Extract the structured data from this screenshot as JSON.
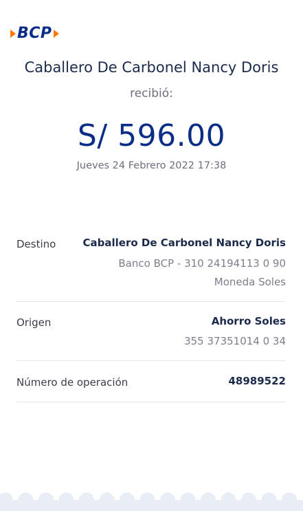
{
  "brand": {
    "logo_text": "BCP"
  },
  "receipt": {
    "recipient_name": "Caballero De Carbonel Nancy Doris",
    "received_label": "recibió:",
    "amount": "S/ 596.00",
    "datetime": "Jueves 24 Febrero 2022 17:38"
  },
  "details": {
    "destino": {
      "label": "Destino",
      "name": "Caballero De Carbonel Nancy Doris",
      "account": "Banco BCP - 310 24194113 0 90",
      "currency": "Moneda Soles"
    },
    "origen": {
      "label": "Origen",
      "account_type": "Ahorro Soles",
      "account_number": "355 37351014 0 34"
    },
    "operacion": {
      "label": "Número de operación",
      "number": "48989522"
    }
  },
  "colors": {
    "brand_blue": "#0a2e87",
    "brand_orange": "#ff7800"
  }
}
